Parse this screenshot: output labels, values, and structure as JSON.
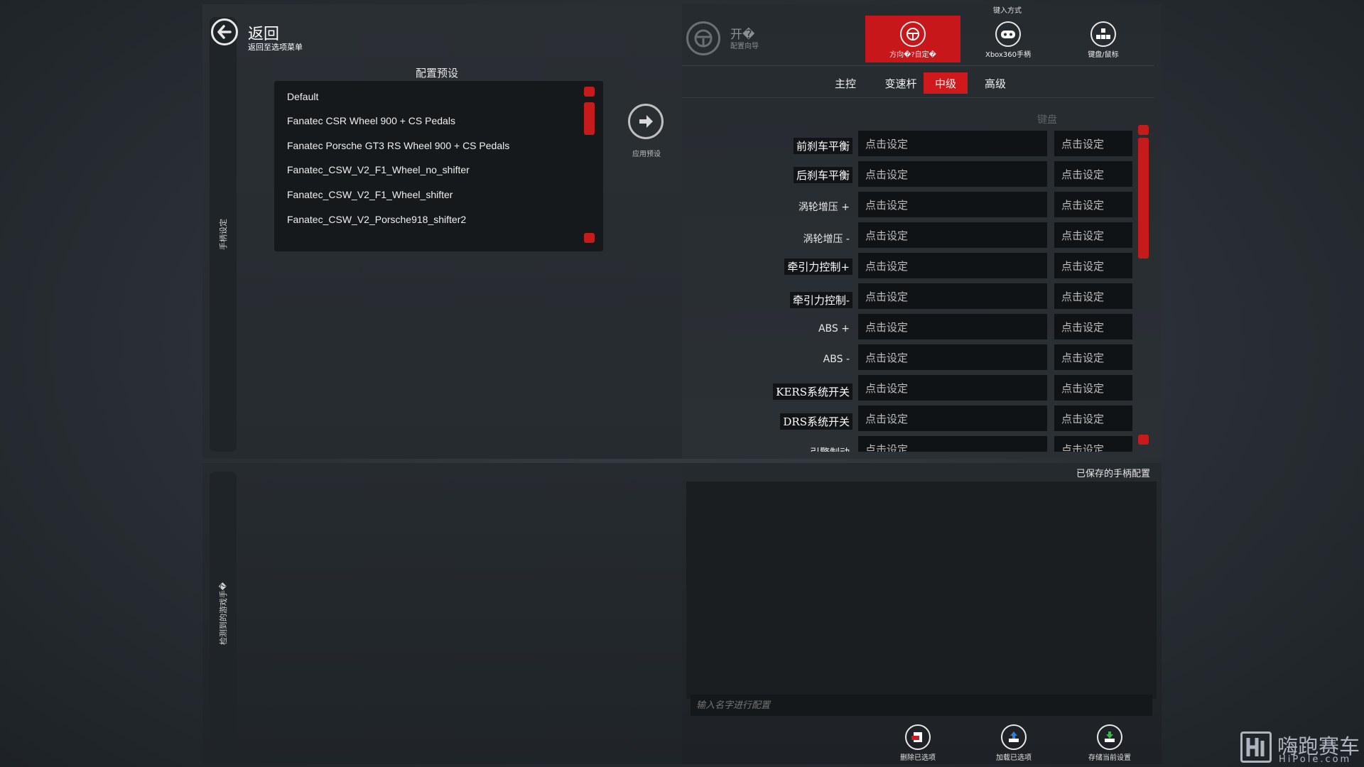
{
  "back": {
    "title": "返回",
    "subtitle": "返回至选项菜单"
  },
  "left_side_label": "手柄设定",
  "presets": {
    "header": "配置预设",
    "items": [
      "Default",
      "Fanatec CSR Wheel 900 + CS Pedals",
      "Fanatec Porsche GT3 RS Wheel 900 + CS Pedals",
      "Fanatec_CSW_V2_F1_Wheel_no_shifter",
      "Fanatec_CSW_V2_F1_Wheel_shifter",
      "Fanatec_CSW_V2_Porsche918_shifter2"
    ],
    "apply_label": "应用预设"
  },
  "wizard": {
    "title": "开�",
    "subtitle": "配置向导"
  },
  "input_mode": {
    "header": "键入方式",
    "modes": [
      {
        "label": "方向�?自定�",
        "icon": "steering-wheel-icon",
        "active": true
      },
      {
        "label": "Xbox360手柄",
        "icon": "gamepad-icon",
        "active": false
      },
      {
        "label": "键盘/鼠标",
        "icon": "keyboard-icon",
        "active": false
      }
    ]
  },
  "tabs": [
    {
      "label": "主控",
      "active": false
    },
    {
      "label": "变速杆",
      "active": false
    },
    {
      "label": "中级",
      "active": true
    },
    {
      "label": "高级",
      "active": false
    }
  ],
  "bindings": {
    "column_header": "键盘",
    "unset_text": "点击设定",
    "rows": [
      {
        "label": "前刹车平衡",
        "style": "boxed"
      },
      {
        "label": "后刹车平衡",
        "style": "boxed"
      },
      {
        "label": "涡轮增压 +",
        "style": "plain"
      },
      {
        "label": "涡轮增压 -",
        "style": "plain"
      },
      {
        "label": "牵引力控制+",
        "style": "boxed"
      },
      {
        "label": "牵引力控制-",
        "style": "boxed"
      },
      {
        "label": "ABS +",
        "style": "plain"
      },
      {
        "label": "ABS -",
        "style": "plain"
      },
      {
        "label": "KERS系统开关",
        "style": "boxed"
      },
      {
        "label": "DRS系统开关",
        "style": "boxed"
      },
      {
        "label": "引擎制动",
        "style": "plain"
      }
    ]
  },
  "detected_label": "检测到的游戏手�",
  "saved": {
    "header": "已保存的手柄配置",
    "name_placeholder": "输入名字进行配置"
  },
  "footer_buttons": [
    {
      "label": "删除已选项",
      "icon": "delete-icon",
      "color": "#d0191d"
    },
    {
      "label": "加载已选项",
      "icon": "load-icon",
      "color": "#2f7fd6"
    },
    {
      "label": "存储当前设置",
      "icon": "save-icon",
      "color": "#3bb34a"
    }
  ],
  "watermark": {
    "text": "嗨跑赛车",
    "sub": "HiPole.com"
  },
  "colors": {
    "accent": "#d0191d",
    "panel": "#262b30",
    "field": "#101316"
  }
}
